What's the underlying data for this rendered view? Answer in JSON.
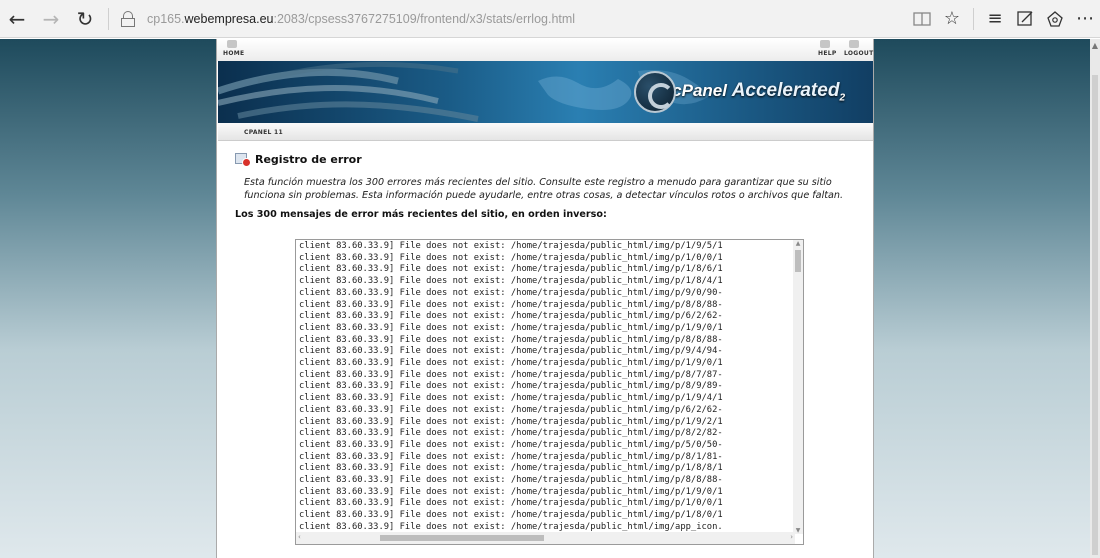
{
  "browser": {
    "url_prefix": "cp165.",
    "url_domain": "webempresa.eu",
    "url_rest": ":2083/cpsess3767275109/frontend/x3/stats/errlog.html",
    "icons": {
      "back": "←",
      "forward": "→",
      "refresh": "↻",
      "reading_view": "reading-view-icon",
      "favorite": "☆",
      "hub": "≡",
      "notes": "web-note-icon",
      "share": "share-icon",
      "more": "⋯"
    }
  },
  "topnav": {
    "home": "HOME",
    "help": "HELP",
    "logout": "LOGOUT"
  },
  "banner": {
    "brand_c": "cPanel",
    "brand_acc": "Accelerated",
    "brand_sub": "2"
  },
  "subnav": {
    "item": "CPANEL 11"
  },
  "main": {
    "title": "Registro de error",
    "description": "Esta función muestra los 300 errores más recientes del sitio. Consulte este registro a menudo para garantizar que su sitio funciona sin problemas. Esta información puede ayudarle, entre otras cosas, a detectar vínculos rotos o archivos que faltan.",
    "subheading": "Los 300 mensajes de error más recientes del sitio, en orden inverso:"
  },
  "log": {
    "lines": [
      "client 83.60.33.9] File does not exist: /home/trajesda/public_html/img/p/1/9/5/1",
      "client 83.60.33.9] File does not exist: /home/trajesda/public_html/img/p/1/0/0/1",
      "client 83.60.33.9] File does not exist: /home/trajesda/public_html/img/p/1/8/6/1",
      "client 83.60.33.9] File does not exist: /home/trajesda/public_html/img/p/1/8/4/1",
      "client 83.60.33.9] File does not exist: /home/trajesda/public_html/img/p/9/0/90-",
      "client 83.60.33.9] File does not exist: /home/trajesda/public_html/img/p/8/8/88-",
      "client 83.60.33.9] File does not exist: /home/trajesda/public_html/img/p/6/2/62-",
      "client 83.60.33.9] File does not exist: /home/trajesda/public_html/img/p/1/9/0/1",
      "client 83.60.33.9] File does not exist: /home/trajesda/public_html/img/p/8/8/88-",
      "client 83.60.33.9] File does not exist: /home/trajesda/public_html/img/p/9/4/94-",
      "client 83.60.33.9] File does not exist: /home/trajesda/public_html/img/p/1/9/0/1",
      "client 83.60.33.9] File does not exist: /home/trajesda/public_html/img/p/8/7/87-",
      "client 83.60.33.9] File does not exist: /home/trajesda/public_html/img/p/8/9/89-",
      "client 83.60.33.9] File does not exist: /home/trajesda/public_html/img/p/1/9/4/1",
      "client 83.60.33.9] File does not exist: /home/trajesda/public_html/img/p/6/2/62-",
      "client 83.60.33.9] File does not exist: /home/trajesda/public_html/img/p/1/9/2/1",
      "client 83.60.33.9] File does not exist: /home/trajesda/public_html/img/p/8/2/82-",
      "client 83.60.33.9] File does not exist: /home/trajesda/public_html/img/p/5/0/50-",
      "client 83.60.33.9] File does not exist: /home/trajesda/public_html/img/p/8/1/81-",
      "client 83.60.33.9] File does not exist: /home/trajesda/public_html/img/p/1/8/8/1",
      "client 83.60.33.9] File does not exist: /home/trajesda/public_html/img/p/8/8/88-",
      "client 83.60.33.9] File does not exist: /home/trajesda/public_html/img/p/1/9/0/1",
      "client 83.60.33.9] File does not exist: /home/trajesda/public_html/img/p/1/0/0/1",
      "client 83.60.33.9] File does not exist: /home/trajesda/public_html/img/p/1/8/0/1",
      "client 83.60.33.9] File does not exist: /home/trajesda/public_html/img/app_icon."
    ]
  }
}
